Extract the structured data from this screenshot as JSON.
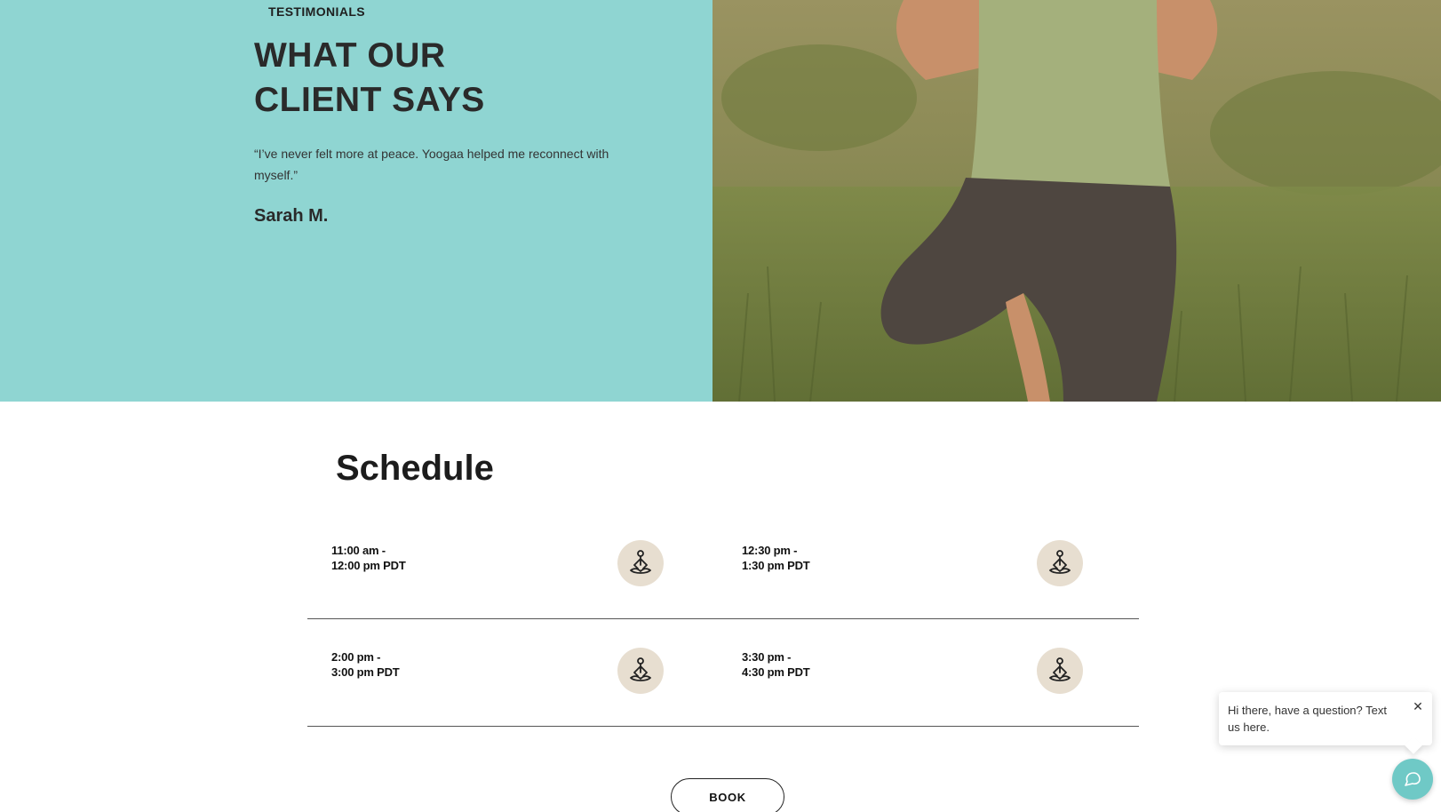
{
  "testimonials": {
    "eyebrow": "TESTIMONIALS",
    "headline_line1": "WHAT OUR",
    "headline_line2": "CLIENT SAYS",
    "quote": "“I’ve never felt more at peace. Yoogaa helped me reconnect with myself.”",
    "author": "Sarah M.",
    "bg_color": "#8fd5d2"
  },
  "schedule": {
    "title": "Schedule",
    "slots": [
      {
        "start": "11:00 am -",
        "end": "12:00 pm PDT",
        "icon": "meditation-icon"
      },
      {
        "start": "12:30 pm -",
        "end": "1:30 pm PDT",
        "icon": "meditation-icon"
      },
      {
        "start": "2:00 pm -",
        "end": "3:00 pm PDT",
        "icon": "meditation-icon"
      },
      {
        "start": "3:30 pm -",
        "end": "4:30 pm PDT",
        "icon": "meditation-icon"
      }
    ],
    "book_label": "BOOK"
  },
  "chat": {
    "message": "Hi there, have a question? Text us here.",
    "close_icon": "close-icon",
    "fab_icon": "chat-icon",
    "accent": "#6fc9c6"
  }
}
